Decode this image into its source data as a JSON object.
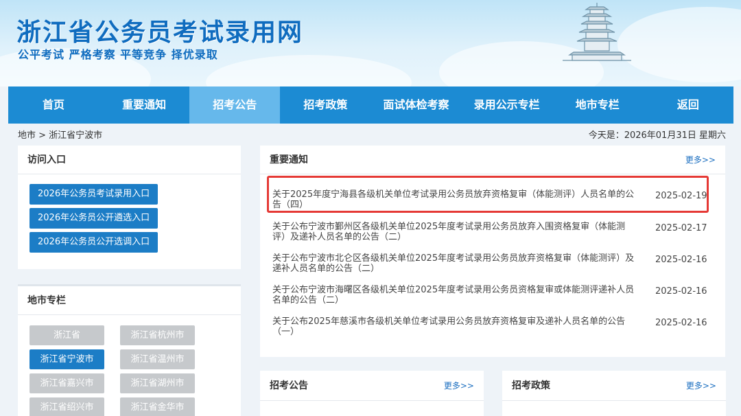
{
  "header": {
    "site_title": "浙江省公务员考试录用网",
    "slogan": "公平考试 严格考察 平等竞争 择优录取"
  },
  "nav": {
    "items": [
      {
        "label": "首页"
      },
      {
        "label": "重要通知"
      },
      {
        "label": "招考公告"
      },
      {
        "label": "招考政策"
      },
      {
        "label": "面试体检考察"
      },
      {
        "label": "录用公示专栏"
      },
      {
        "label": "地市专栏"
      },
      {
        "label": "返回"
      }
    ],
    "active_index": 2,
    "active_color": "#66b8eb",
    "bar_color": "#1c8bd3"
  },
  "breadcrumb": "地市 > 浙江省宁波市",
  "today": "今天是：2026年01月31日 星期六",
  "access": {
    "title": "访问入口",
    "entries": [
      {
        "label": "2026年公务员考试录用入口"
      },
      {
        "label": "2026年公务员公开遴选入口"
      },
      {
        "label": "2026年公务员公开选调入口"
      }
    ]
  },
  "cities": {
    "title": "地市专栏",
    "items": [
      {
        "label": "浙江省",
        "active": false
      },
      {
        "label": "浙江省杭州市",
        "active": false
      },
      {
        "label": "浙江省宁波市",
        "active": true
      },
      {
        "label": "浙江省温州市",
        "active": false
      },
      {
        "label": "浙江省嘉兴市",
        "active": false
      },
      {
        "label": "浙江省湖州市",
        "active": false
      },
      {
        "label": "浙江省绍兴市",
        "active": false
      },
      {
        "label": "浙江省金华市",
        "active": false
      }
    ]
  },
  "notices": {
    "title": "重要通知",
    "more": "更多>>",
    "items": [
      {
        "title": "关于2025年度宁海县各级机关单位考试录用公务员放弃资格复审（体能测评）人员名单的公告（四）",
        "date": "2025-02-19",
        "highlighted": true
      },
      {
        "title": "关于公布宁波市鄞州区各级机关单位2025年度考试录用公务员放弃入围资格复审（体能测评）及递补人员名单的公告（二）",
        "date": "2025-02-17",
        "highlighted": false
      },
      {
        "title": "关于公布宁波市北仑区各级机关单位2025年度考试录用公务员放弃资格复审（体能测评）及递补人员名单的公告（二）",
        "date": "2025-02-16",
        "highlighted": false
      },
      {
        "title": "关于公布宁波市海曙区各级机关单位2025年度考试录用公务员资格复审或体能测评递补人员名单的公告（二）",
        "date": "2025-02-16",
        "highlighted": false
      },
      {
        "title": "关于公布2025年慈溪市各级机关单位考试录用公务员放弃资格复审及递补人员名单的公告（一）",
        "date": "2025-02-16",
        "highlighted": false
      }
    ],
    "highlight_color": "#e53935"
  },
  "recruit": {
    "title": "招考公告",
    "more": "更多>>"
  },
  "policy": {
    "title": "招考政策",
    "more": "更多>>"
  }
}
